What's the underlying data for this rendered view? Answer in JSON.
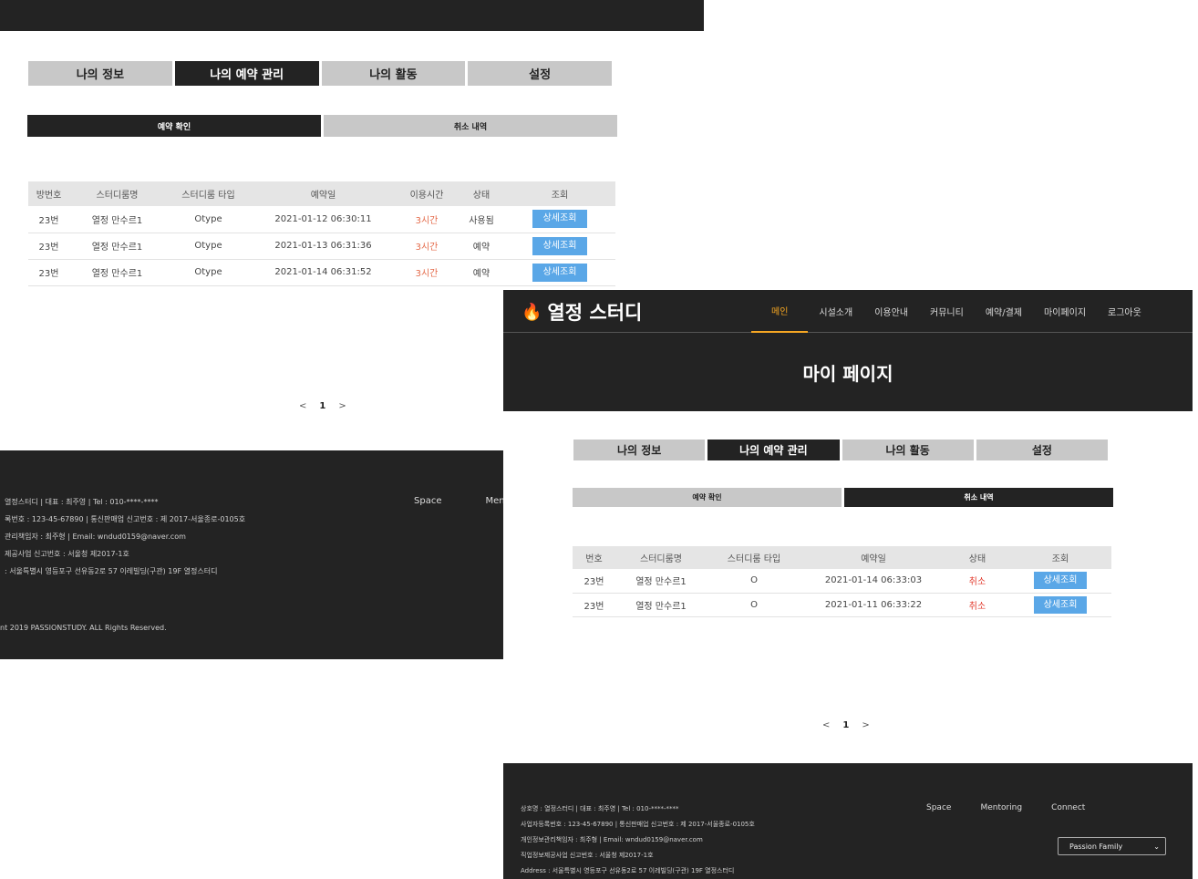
{
  "back": {
    "tabs": [
      "나의 정보",
      "나의 예약 관리",
      "나의 활동",
      "설정"
    ],
    "subtabs": [
      "예약 확인",
      "취소 내역"
    ],
    "table": {
      "headers": [
        "방번호",
        "스터디룸명",
        "스터디룸 타입",
        "예약일",
        "이용시간",
        "상태",
        "조회"
      ],
      "rows": [
        [
          "23번",
          "열정 만수르1",
          "Otype",
          "2021-01-12 06:30:11",
          "3시간",
          "사용됨",
          "상세조회"
        ],
        [
          "23번",
          "열정 만수르1",
          "Otype",
          "2021-01-13 06:31:36",
          "3시간",
          "예약",
          "상세조회"
        ],
        [
          "23번",
          "열정 만수르1",
          "Otype",
          "2021-01-14 06:31:52",
          "3시간",
          "예약",
          "상세조회"
        ]
      ]
    },
    "pager": {
      "prev": "<",
      "current": "1",
      "next": ">"
    },
    "footer": {
      "line1": "열정스터디 | 대표 : 최주영 | Tel : 010-****-****",
      "line2": "록번호 : 123-45-67890 | 통신판매업 신고번호 : 제 2017-서울종로-0105호",
      "line3": "관리책임자 : 최주형 | Email: wndud0159@naver.com",
      "line4": "제공사업 신고번호 : 서울청 제2017-1호",
      "line5": ": 서울특별시 영등포구 선유동2로 57 이레빌딩(구관) 19F 열정스터디",
      "copyright": "nt 2019 PASSIONSTUDY. ALL Rights Reserved.",
      "link_space": "Space",
      "link_mentoring": "Mentori"
    }
  },
  "front": {
    "logo": {
      "icon": "flame-icon",
      "text": "열정 스터디"
    },
    "nav": [
      "메인",
      "시설소개",
      "이용안내",
      "커뮤니티",
      "예약/결제",
      "마이페이지",
      "로그아웃"
    ],
    "banner_title": "마이 페이지",
    "tabs": [
      "나의 정보",
      "나의 예약 관리",
      "나의 활동",
      "설정"
    ],
    "subtabs": [
      "예약 확인",
      "취소 내역"
    ],
    "table": {
      "headers": [
        "번호",
        "스터디룸명",
        "스터디룸 타입",
        "예약일",
        "상태",
        "조회"
      ],
      "rows": [
        [
          "23번",
          "열정 만수르1",
          "O",
          "2021-01-14 06:33:03",
          "취소",
          "상세조회"
        ],
        [
          "23번",
          "열정 만수르1",
          "O",
          "2021-01-11 06:33:22",
          "취소",
          "상세조회"
        ]
      ]
    },
    "pager": {
      "prev": "<",
      "current": "1",
      "next": ">"
    },
    "footer": {
      "line1": "상호명 : 열정스터디 | 대표 : 최주영 | Tel : 010-****-****",
      "line2": "사업자등록번호 : 123-45-67890 | 통신판매업 신고번호 : 제 2017-서울종로-0105호",
      "line3": "개인정보관리책임자 : 최주형 | Email: wndud0159@naver.com",
      "line4": "직업정보제공사업 신고번호 : 서울청 제2017-1호",
      "line5": "Address : 서울특별시 영등포구 선유동2로 57 이레빌딩(구관) 19F 열정스터디",
      "link_space": "Space",
      "link_mentoring": "Mentoring",
      "link_connect": "Connect",
      "family_select": "Passion Family"
    }
  },
  "colors": {
    "dark": "#232323",
    "accent": "#f5a623",
    "button": "#5aa7e7",
    "time": "#e46b4b",
    "cancel": "#e23b2e",
    "tab_inactive": "#c8c8c8"
  }
}
